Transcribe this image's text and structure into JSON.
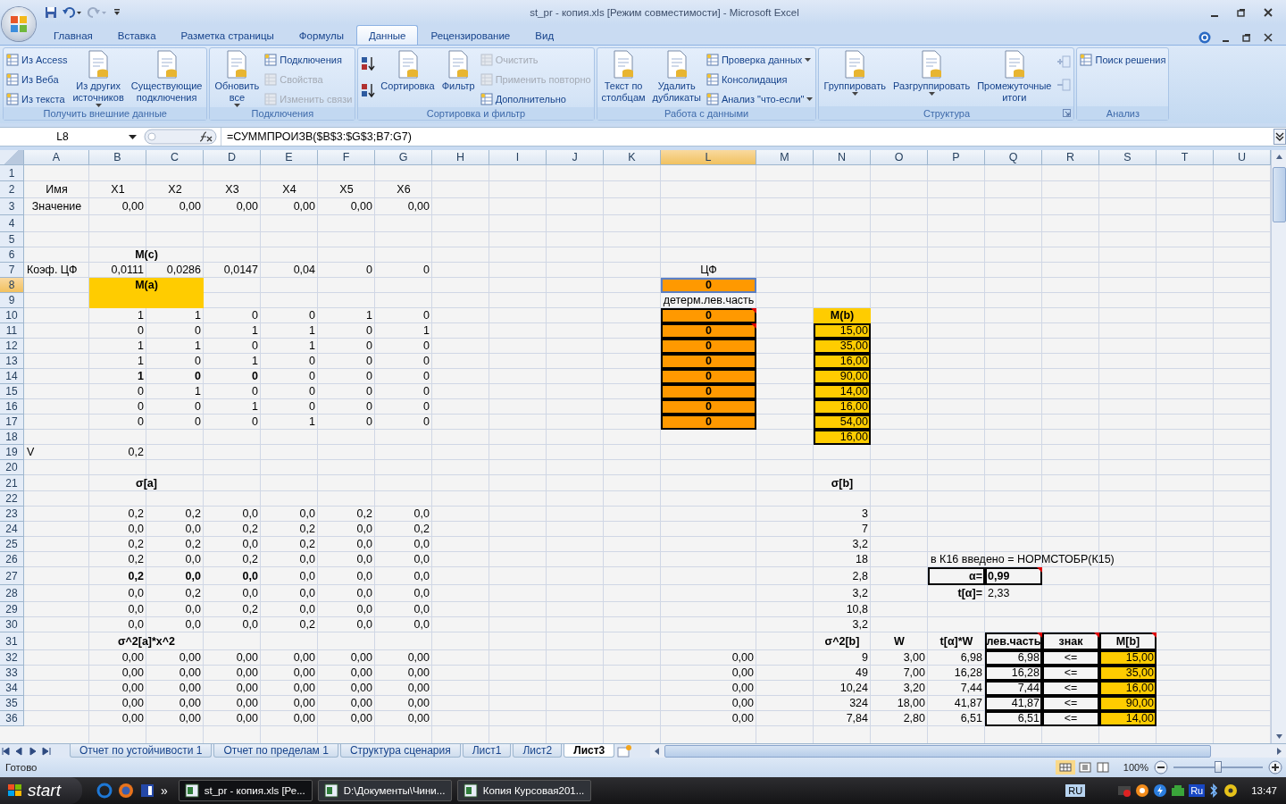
{
  "window": {
    "title": "st_pr - копия.xls  [Режим совместимости] - Microsoft Excel"
  },
  "tabs": [
    {
      "label": "Главная",
      "selected": false
    },
    {
      "label": "Вставка",
      "selected": false
    },
    {
      "label": "Разметка страницы",
      "selected": false
    },
    {
      "label": "Формулы",
      "selected": false
    },
    {
      "label": "Данные",
      "selected": true
    },
    {
      "label": "Рецензирование",
      "selected": false
    },
    {
      "label": "Вид",
      "selected": false
    }
  ],
  "ribbon": [
    {
      "label": "Получить внешние данные",
      "columns": [
        {
          "kind": "stack",
          "items": [
            {
              "label": "Из Access",
              "disabled": false
            },
            {
              "label": "Из Веба",
              "disabled": false
            },
            {
              "label": "Из текста",
              "disabled": false
            }
          ]
        },
        {
          "kind": "large",
          "lines": [
            "Из других",
            "источников"
          ],
          "dropdown": true,
          "disabled": false
        },
        {
          "kind": "large",
          "lines": [
            "Существующие",
            "подключения"
          ],
          "disabled": false
        }
      ]
    },
    {
      "label": "Подключения",
      "columns": [
        {
          "kind": "large",
          "lines": [
            "Обновить",
            "все"
          ],
          "dropdown": true,
          "disabled": false
        },
        {
          "kind": "stack",
          "items": [
            {
              "label": "Подключения",
              "disabled": false
            },
            {
              "label": "Свойства",
              "disabled": true
            },
            {
              "label": "Изменить связи",
              "disabled": true
            }
          ]
        }
      ]
    },
    {
      "label": "Сортировка и фильтр",
      "columns": [
        {
          "kind": "sort"
        },
        {
          "kind": "large",
          "lines": [
            "Сортировка"
          ],
          "disabled": false
        },
        {
          "kind": "large",
          "lines": [
            "Фильтр"
          ],
          "disabled": false
        },
        {
          "kind": "stack",
          "items": [
            {
              "label": "Очистить",
              "disabled": true
            },
            {
              "label": "Применить повторно",
              "disabled": true
            },
            {
              "label": "Дополнительно",
              "disabled": false
            }
          ]
        }
      ]
    },
    {
      "label": "Работа с данными",
      "columns": [
        {
          "kind": "large",
          "lines": [
            "Текст по",
            "столбцам"
          ],
          "disabled": false
        },
        {
          "kind": "large",
          "lines": [
            "Удалить",
            "дубликаты"
          ],
          "disabled": false
        },
        {
          "kind": "stack",
          "items": [
            {
              "label": "Проверка данных",
              "disabled": false,
              "dropdown": true
            },
            {
              "label": "Консолидация",
              "disabled": false
            },
            {
              "label": "Анализ \"что-если\"",
              "disabled": false,
              "dropdown": true
            }
          ]
        }
      ]
    },
    {
      "label": "Структура",
      "columns": [
        {
          "kind": "large",
          "lines": [
            "Группировать"
          ],
          "dropdown": true,
          "disabled": false
        },
        {
          "kind": "large",
          "lines": [
            "Разгруппировать"
          ],
          "dropdown": true,
          "disabled": false
        },
        {
          "kind": "large",
          "lines": [
            "Промежуточные",
            "итоги"
          ],
          "disabled": false
        },
        {
          "kind": "outline"
        }
      ],
      "launcher": true
    },
    {
      "label": "Анализ",
      "columns": [
        {
          "kind": "stack",
          "items": [
            {
              "label": "Поиск решения",
              "disabled": false
            }
          ]
        }
      ]
    }
  ],
  "name_box": "L8",
  "formula": "=СУММПРОИЗВ($B$3:$G$3;B7:G7)",
  "columns": [
    {
      "label": "A",
      "selected": false
    },
    {
      "label": "B",
      "selected": false
    },
    {
      "label": "C",
      "selected": false
    },
    {
      "label": "D",
      "selected": false
    },
    {
      "label": "E",
      "selected": false
    },
    {
      "label": "F",
      "selected": false
    },
    {
      "label": "G",
      "selected": false
    },
    {
      "label": "H",
      "selected": false
    },
    {
      "label": "I",
      "selected": false
    },
    {
      "label": "J",
      "selected": false
    },
    {
      "label": "K",
      "selected": false
    },
    {
      "label": "L",
      "selected": true
    },
    {
      "label": "M",
      "selected": false
    },
    {
      "label": "N",
      "selected": false
    },
    {
      "label": "O",
      "selected": false
    },
    {
      "label": "P",
      "selected": false
    },
    {
      "label": "Q",
      "selected": false
    },
    {
      "label": "R",
      "selected": false
    },
    {
      "label": "S",
      "selected": false
    },
    {
      "label": "T",
      "selected": false
    },
    {
      "label": "U",
      "selected": false
    }
  ],
  "rows": [
    {
      "number": "1",
      "selected": false
    },
    {
      "number": "2",
      "selected": false,
      "cells": [
        {
          "text": "Имя",
          "kind": "head"
        },
        {
          "text": "X1",
          "kind": "head"
        },
        {
          "text": "X2",
          "kind": "head"
        },
        {
          "text": "X3",
          "kind": "head"
        },
        {
          "text": "X4",
          "kind": "head"
        },
        {
          "text": "X5",
          "kind": "head"
        },
        {
          "text": "X6",
          "kind": "head"
        }
      ]
    },
    {
      "number": "3",
      "selected": false,
      "cells": [
        {
          "text": "Значение",
          "kind": "head"
        },
        {
          "text": "0,00",
          "kind": "num"
        },
        {
          "text": "0,00",
          "kind": "num"
        },
        {
          "text": "0,00",
          "kind": "num"
        },
        {
          "text": "0,00",
          "kind": "num"
        },
        {
          "text": "0,00",
          "kind": "num"
        },
        {
          "text": "0,00",
          "kind": "num"
        }
      ]
    },
    {
      "number": "4",
      "selected": false
    },
    {
      "number": "5",
      "selected": false
    },
    {
      "number": "6",
      "selected": false,
      "cells": [
        null,
        {
          "text": "M(c)",
          "kind": "head",
          "bold": true,
          "merge": true
        }
      ]
    },
    {
      "number": "7",
      "selected": false,
      "cells": [
        {
          "text": "Коэф. ЦФ",
          "kind": "text"
        },
        {
          "text": "0,0111",
          "kind": "num"
        },
        {
          "text": "0,0286",
          "kind": "num"
        },
        {
          "text": "0,0147",
          "kind": "num"
        },
        {
          "text": "0,04",
          "kind": "num"
        },
        {
          "text": "0",
          "kind": "num"
        },
        {
          "text": "0",
          "kind": "num"
        },
        null,
        null,
        null,
        null,
        {
          "text": "ЦФ",
          "kind": "head"
        }
      ]
    },
    {
      "number": "8",
      "selected": true,
      "cells": [
        null,
        {
          "text": "M(a)",
          "kind": "head",
          "bold": true,
          "merge": true,
          "color": "#ffcc00"
        },
        null,
        null,
        null,
        null,
        null,
        null,
        null,
        null,
        null,
        {
          "text": "0",
          "kind": "head",
          "bold": true,
          "color": "#ff9900"
        }
      ]
    },
    {
      "number": "9",
      "selected": false,
      "cells": [
        null,
        {
          "kind": "head",
          "merge": true,
          "color": "#ffcc00"
        },
        null,
        null,
        null,
        null,
        null,
        null,
        null,
        null,
        null,
        {
          "text": "детерм.лев.часть",
          "kind": "head"
        }
      ]
    },
    {
      "number": "10",
      "selected": false,
      "cells": [
        null,
        {
          "text": "1",
          "kind": "num"
        },
        {
          "text": "1",
          "kind": "num"
        },
        {
          "text": "0",
          "kind": "num"
        },
        {
          "text": "0",
          "kind": "num"
        },
        {
          "text": "1",
          "kind": "num"
        },
        {
          "text": "0",
          "kind": "num"
        },
        null,
        null,
        null,
        null,
        {
          "text": "0",
          "kind": "head",
          "bold": true,
          "color": "#ff9900",
          "boxed": true,
          "comment": true
        },
        null,
        {
          "text": "M(b)",
          "kind": "head",
          "bold": true,
          "color": "#ffcc00"
        }
      ]
    },
    {
      "number": "11",
      "selected": false,
      "cells": [
        null,
        {
          "text": "0",
          "kind": "num"
        },
        {
          "text": "0",
          "kind": "num"
        },
        {
          "text": "1",
          "kind": "num"
        },
        {
          "text": "1",
          "kind": "num"
        },
        {
          "text": "0",
          "kind": "num"
        },
        {
          "text": "1",
          "kind": "num"
        },
        null,
        null,
        null,
        null,
        {
          "text": "0",
          "kind": "head",
          "bold": true,
          "color": "#ff9900",
          "boxed": true,
          "comment": true
        },
        null,
        {
          "text": "15,00",
          "kind": "num",
          "color": "#ffcc00",
          "boxed": true
        }
      ]
    },
    {
      "number": "12",
      "selected": false,
      "cells": [
        null,
        {
          "text": "1",
          "kind": "num"
        },
        {
          "text": "1",
          "kind": "num"
        },
        {
          "text": "0",
          "kind": "num"
        },
        {
          "text": "1",
          "kind": "num"
        },
        {
          "text": "0",
          "kind": "num"
        },
        {
          "text": "0",
          "kind": "num"
        },
        null,
        null,
        null,
        null,
        {
          "text": "0",
          "kind": "head",
          "bold": true,
          "color": "#ff9900",
          "boxed": true
        },
        null,
        {
          "text": "35,00",
          "kind": "num",
          "color": "#ffcc00",
          "boxed": true
        }
      ]
    },
    {
      "number": "13",
      "selected": false,
      "cells": [
        null,
        {
          "text": "1",
          "kind": "num"
        },
        {
          "text": "0",
          "kind": "num"
        },
        {
          "text": "1",
          "kind": "num"
        },
        {
          "text": "0",
          "kind": "num"
        },
        {
          "text": "0",
          "kind": "num"
        },
        {
          "text": "0",
          "kind": "num"
        },
        null,
        null,
        null,
        null,
        {
          "text": "0",
          "kind": "head",
          "bold": true,
          "color": "#ff9900",
          "boxed": true
        },
        null,
        {
          "text": "16,00",
          "kind": "num",
          "color": "#ffcc00",
          "boxed": true
        }
      ]
    },
    {
      "number": "14",
      "selected": false,
      "cells": [
        null,
        {
          "text": "1",
          "kind": "num",
          "bold": true
        },
        {
          "text": "0",
          "kind": "num",
          "bold": true
        },
        {
          "text": "0",
          "kind": "num",
          "bold": true
        },
        {
          "text": "0",
          "kind": "num"
        },
        {
          "text": "0",
          "kind": "num"
        },
        {
          "text": "0",
          "kind": "num"
        },
        null,
        null,
        null,
        null,
        {
          "text": "0",
          "kind": "head",
          "bold": true,
          "color": "#ff9900",
          "boxed": true
        },
        null,
        {
          "text": "90,00",
          "kind": "num",
          "color": "#ffcc00",
          "boxed": true
        }
      ]
    },
    {
      "number": "15",
      "selected": false,
      "cells": [
        null,
        {
          "text": "0",
          "kind": "num"
        },
        {
          "text": "1",
          "kind": "num"
        },
        {
          "text": "0",
          "kind": "num"
        },
        {
          "text": "0",
          "kind": "num"
        },
        {
          "text": "0",
          "kind": "num"
        },
        {
          "text": "0",
          "kind": "num"
        },
        null,
        null,
        null,
        null,
        {
          "text": "0",
          "kind": "head",
          "bold": true,
          "color": "#ff9900",
          "boxed": true
        },
        null,
        {
          "text": "14,00",
          "kind": "num",
          "color": "#ffcc00",
          "boxed": true
        }
      ]
    },
    {
      "number": "16",
      "selected": false,
      "cells": [
        null,
        {
          "text": "0",
          "kind": "num"
        },
        {
          "text": "0",
          "kind": "num"
        },
        {
          "text": "1",
          "kind": "num"
        },
        {
          "text": "0",
          "kind": "num"
        },
        {
          "text": "0",
          "kind": "num"
        },
        {
          "text": "0",
          "kind": "num"
        },
        null,
        null,
        null,
        null,
        {
          "text": "0",
          "kind": "head",
          "bold": true,
          "color": "#ff9900",
          "boxed": true
        },
        null,
        {
          "text": "16,00",
          "kind": "num",
          "color": "#ffcc00",
          "boxed": true
        }
      ]
    },
    {
      "number": "17",
      "selected": false,
      "cells": [
        null,
        {
          "text": "0",
          "kind": "num"
        },
        {
          "text": "0",
          "kind": "num"
        },
        {
          "text": "0",
          "kind": "num"
        },
        {
          "text": "1",
          "kind": "num"
        },
        {
          "text": "0",
          "kind": "num"
        },
        {
          "text": "0",
          "kind": "num"
        },
        null,
        null,
        null,
        null,
        {
          "text": "0",
          "kind": "head",
          "bold": true,
          "color": "#ff9900",
          "boxed": true
        },
        null,
        {
          "text": "54,00",
          "kind": "num",
          "color": "#ffcc00",
          "boxed": true
        }
      ]
    },
    {
      "number": "18",
      "selected": false,
      "cells": [
        null,
        null,
        null,
        null,
        null,
        null,
        null,
        null,
        null,
        null,
        null,
        null,
        null,
        {
          "text": "16,00",
          "kind": "num",
          "color": "#ffcc00",
          "boxed": true
        }
      ]
    },
    {
      "number": "19",
      "selected": false,
      "cells": [
        {
          "text": "V",
          "kind": "text"
        },
        {
          "text": "0,2",
          "kind": "num"
        }
      ]
    },
    {
      "number": "20",
      "selected": false
    },
    {
      "number": "21",
      "selected": false,
      "cells": [
        null,
        {
          "text": "σ[a]",
          "kind": "head",
          "bold": true,
          "merge": true
        },
        null,
        null,
        null,
        null,
        null,
        null,
        null,
        null,
        null,
        null,
        null,
        {
          "text": "σ[b]",
          "kind": "head",
          "bold": true
        }
      ]
    },
    {
      "number": "22",
      "selected": false
    },
    {
      "number": "23",
      "selected": false,
      "cells": [
        null,
        {
          "text": "0,2",
          "kind": "num"
        },
        {
          "text": "0,2",
          "kind": "num"
        },
        {
          "text": "0,0",
          "kind": "num"
        },
        {
          "text": "0,0",
          "kind": "num"
        },
        {
          "text": "0,2",
          "kind": "num"
        },
        {
          "text": "0,0",
          "kind": "num"
        },
        null,
        null,
        null,
        null,
        null,
        null,
        {
          "text": "3",
          "kind": "num"
        }
      ]
    },
    {
      "number": "24",
      "selected": false,
      "cells": [
        null,
        {
          "text": "0,0",
          "kind": "num"
        },
        {
          "text": "0,0",
          "kind": "num"
        },
        {
          "text": "0,2",
          "kind": "num"
        },
        {
          "text": "0,2",
          "kind": "num"
        },
        {
          "text": "0,0",
          "kind": "num"
        },
        {
          "text": "0,2",
          "kind": "num"
        },
        null,
        null,
        null,
        null,
        null,
        null,
        {
          "text": "7",
          "kind": "num"
        }
      ]
    },
    {
      "number": "25",
      "selected": false,
      "cells": [
        null,
        {
          "text": "0,2",
          "kind": "num"
        },
        {
          "text": "0,2",
          "kind": "num"
        },
        {
          "text": "0,0",
          "kind": "num"
        },
        {
          "text": "0,2",
          "kind": "num"
        },
        {
          "text": "0,0",
          "kind": "num"
        },
        {
          "text": "0,0",
          "kind": "num"
        },
        null,
        null,
        null,
        null,
        null,
        null,
        {
          "text": "3,2",
          "kind": "num"
        }
      ]
    },
    {
      "number": "26",
      "selected": false,
      "cells": [
        null,
        {
          "text": "0,2",
          "kind": "num"
        },
        {
          "text": "0,0",
          "kind": "num"
        },
        {
          "text": "0,2",
          "kind": "num"
        },
        {
          "text": "0,0",
          "kind": "num"
        },
        {
          "text": "0,0",
          "kind": "num"
        },
        {
          "text": "0,0",
          "kind": "num"
        },
        null,
        null,
        null,
        null,
        null,
        null,
        {
          "text": "18",
          "kind": "num"
        },
        null,
        {
          "text": "в К16 введено = НОРМСТОБР(К15)",
          "kind": "text"
        }
      ]
    },
    {
      "number": "27",
      "selected": false,
      "cells": [
        null,
        {
          "text": "0,2",
          "kind": "num",
          "bold": true
        },
        {
          "text": "0,0",
          "kind": "num",
          "bold": true
        },
        {
          "text": "0,0",
          "kind": "num",
          "bold": true
        },
        {
          "text": "0,0",
          "kind": "num"
        },
        {
          "text": "0,0",
          "kind": "num"
        },
        {
          "text": "0,0",
          "kind": "num"
        },
        null,
        null,
        null,
        null,
        null,
        null,
        {
          "text": "2,8",
          "kind": "num"
        },
        null,
        {
          "text": "α=",
          "kind": "num",
          "bold": true,
          "boxed": true
        },
        {
          "text": "0,99",
          "kind": "text",
          "bold": true,
          "boxed": true,
          "comment": true
        }
      ]
    },
    {
      "number": "28",
      "selected": false,
      "cells": [
        null,
        {
          "text": "0,0",
          "kind": "num"
        },
        {
          "text": "0,2",
          "kind": "num"
        },
        {
          "text": "0,0",
          "kind": "num"
        },
        {
          "text": "0,0",
          "kind": "num"
        },
        {
          "text": "0,0",
          "kind": "num"
        },
        {
          "text": "0,0",
          "kind": "num"
        },
        null,
        null,
        null,
        null,
        null,
        null,
        {
          "text": "3,2",
          "kind": "num"
        },
        null,
        {
          "text": "t[α]=",
          "kind": "num",
          "bold": true
        },
        {
          "text": "2,33",
          "kind": "text"
        }
      ]
    },
    {
      "number": "29",
      "selected": false,
      "cells": [
        null,
        {
          "text": "0,0",
          "kind": "num"
        },
        {
          "text": "0,0",
          "kind": "num"
        },
        {
          "text": "0,2",
          "kind": "num"
        },
        {
          "text": "0,0",
          "kind": "num"
        },
        {
          "text": "0,0",
          "kind": "num"
        },
        {
          "text": "0,0",
          "kind": "num"
        },
        null,
        null,
        null,
        null,
        null,
        null,
        {
          "text": "10,8",
          "kind": "num"
        }
      ]
    },
    {
      "number": "30",
      "selected": false,
      "cells": [
        null,
        {
          "text": "0,0",
          "kind": "num"
        },
        {
          "text": "0,0",
          "kind": "num"
        },
        {
          "text": "0,0",
          "kind": "num"
        },
        {
          "text": "0,2",
          "kind": "num"
        },
        {
          "text": "0,0",
          "kind": "num"
        },
        {
          "text": "0,0",
          "kind": "num"
        },
        null,
        null,
        null,
        null,
        null,
        null,
        {
          "text": "3,2",
          "kind": "num"
        }
      ]
    },
    {
      "number": "31",
      "selected": false,
      "cells": [
        null,
        {
          "text": "σ^2[a]*x^2",
          "kind": "head",
          "bold": true,
          "merge": true
        },
        null,
        null,
        null,
        null,
        null,
        null,
        null,
        null,
        null,
        null,
        null,
        {
          "text": "σ^2[b]",
          "kind": "head",
          "bold": true
        },
        {
          "text": "W",
          "kind": "head",
          "bold": true
        },
        {
          "text": "t[α]*W",
          "kind": "head",
          "bold": true
        },
        {
          "text": "лев.часть",
          "kind": "head",
          "bold": true,
          "boxed": true,
          "comment": true
        },
        {
          "text": "знак",
          "kind": "head",
          "bold": true,
          "boxed": true,
          "comment": true
        },
        {
          "text": "M[b]",
          "kind": "head",
          "bold": true,
          "boxed": true,
          "comment": true
        }
      ]
    },
    {
      "number": "32",
      "selected": false,
      "cells": [
        null,
        {
          "text": "0,00",
          "kind": "num"
        },
        {
          "text": "0,00",
          "kind": "num"
        },
        {
          "text": "0,00",
          "kind": "num"
        },
        {
          "text": "0,00",
          "kind": "num"
        },
        {
          "text": "0,00",
          "kind": "num"
        },
        {
          "text": "0,00",
          "kind": "num"
        },
        null,
        null,
        null,
        null,
        {
          "text": "0,00",
          "kind": "num"
        },
        null,
        {
          "text": "9",
          "kind": "num"
        },
        {
          "text": "3,00",
          "kind": "num"
        },
        {
          "text": "6,98",
          "kind": "num"
        },
        {
          "text": "6,98",
          "kind": "num",
          "boxed": true
        },
        {
          "text": "<=",
          "kind": "head",
          "boxed": true
        },
        {
          "text": "15,00",
          "kind": "num",
          "color": "#ffcc00",
          "boxed": true
        }
      ]
    },
    {
      "number": "33",
      "selected": false,
      "cells": [
        null,
        {
          "text": "0,00",
          "kind": "num"
        },
        {
          "text": "0,00",
          "kind": "num"
        },
        {
          "text": "0,00",
          "kind": "num"
        },
        {
          "text": "0,00",
          "kind": "num"
        },
        {
          "text": "0,00",
          "kind": "num"
        },
        {
          "text": "0,00",
          "kind": "num"
        },
        null,
        null,
        null,
        null,
        {
          "text": "0,00",
          "kind": "num"
        },
        null,
        {
          "text": "49",
          "kind": "num"
        },
        {
          "text": "7,00",
          "kind": "num"
        },
        {
          "text": "16,28",
          "kind": "num"
        },
        {
          "text": "16,28",
          "kind": "num",
          "boxed": true
        },
        {
          "text": "<=",
          "kind": "head",
          "boxed": true
        },
        {
          "text": "35,00",
          "kind": "num",
          "color": "#ffcc00",
          "boxed": true
        }
      ]
    },
    {
      "number": "34",
      "selected": false,
      "cells": [
        null,
        {
          "text": "0,00",
          "kind": "num"
        },
        {
          "text": "0,00",
          "kind": "num"
        },
        {
          "text": "0,00",
          "kind": "num"
        },
        {
          "text": "0,00",
          "kind": "num"
        },
        {
          "text": "0,00",
          "kind": "num"
        },
        {
          "text": "0,00",
          "kind": "num"
        },
        null,
        null,
        null,
        null,
        {
          "text": "0,00",
          "kind": "num"
        },
        null,
        {
          "text": "10,24",
          "kind": "num"
        },
        {
          "text": "3,20",
          "kind": "num"
        },
        {
          "text": "7,44",
          "kind": "num"
        },
        {
          "text": "7,44",
          "kind": "num",
          "boxed": true
        },
        {
          "text": "<=",
          "kind": "head",
          "boxed": true
        },
        {
          "text": "16,00",
          "kind": "num",
          "color": "#ffcc00",
          "boxed": true
        }
      ]
    },
    {
      "number": "35",
      "selected": false,
      "cells": [
        null,
        {
          "text": "0,00",
          "kind": "num"
        },
        {
          "text": "0,00",
          "kind": "num"
        },
        {
          "text": "0,00",
          "kind": "num"
        },
        {
          "text": "0,00",
          "kind": "num"
        },
        {
          "text": "0,00",
          "kind": "num"
        },
        {
          "text": "0,00",
          "kind": "num"
        },
        null,
        null,
        null,
        null,
        {
          "text": "0,00",
          "kind": "num"
        },
        null,
        {
          "text": "324",
          "kind": "num"
        },
        {
          "text": "18,00",
          "kind": "num"
        },
        {
          "text": "41,87",
          "kind": "num"
        },
        {
          "text": "41,87",
          "kind": "num",
          "boxed": true
        },
        {
          "text": "<=",
          "kind": "head",
          "boxed": true
        },
        {
          "text": "90,00",
          "kind": "num",
          "color": "#ffcc00",
          "boxed": true
        }
      ]
    },
    {
      "number": "36",
      "selected": false,
      "cells": [
        null,
        {
          "text": "0,00",
          "kind": "num"
        },
        {
          "text": "0,00",
          "kind": "num"
        },
        {
          "text": "0,00",
          "kind": "num"
        },
        {
          "text": "0,00",
          "kind": "num"
        },
        {
          "text": "0,00",
          "kind": "num"
        },
        {
          "text": "0,00",
          "kind": "num"
        },
        null,
        null,
        null,
        null,
        {
          "text": "0,00",
          "kind": "num"
        },
        null,
        {
          "text": "7,84",
          "kind": "num"
        },
        {
          "text": "2,80",
          "kind": "num"
        },
        {
          "text": "6,51",
          "kind": "num"
        },
        {
          "text": "6,51",
          "kind": "num",
          "boxed": true
        },
        {
          "text": "<=",
          "kind": "head",
          "boxed": true
        },
        {
          "text": "14,00",
          "kind": "num",
          "color": "#ffcc00",
          "boxed": true
        }
      ]
    }
  ],
  "sheet_tabs": [
    {
      "label": "Отчет по устойчивости 1",
      "selected": false
    },
    {
      "label": "Отчет по пределам 1",
      "selected": false
    },
    {
      "label": "Структура сценария",
      "selected": false
    },
    {
      "label": "Лист1",
      "selected": false
    },
    {
      "label": "Лист2",
      "selected": false
    },
    {
      "label": "Лист3",
      "selected": true
    }
  ],
  "status_bar": {
    "text": "Готово",
    "zoom": "100%",
    "zoom_slider": {
      "level": 0.5
    }
  },
  "taskbar": {
    "start": "start",
    "more": "»",
    "tasks": [
      {
        "label": "st_pr - копия.xls  [Ре...",
        "selected": true
      },
      {
        "label": "D:\\Документы\\Чини...",
        "selected": false
      },
      {
        "label": "Копия Курсовая201...",
        "selected": false
      }
    ],
    "language": "RU",
    "tray_language": "Ru",
    "clock": "13:47"
  }
}
